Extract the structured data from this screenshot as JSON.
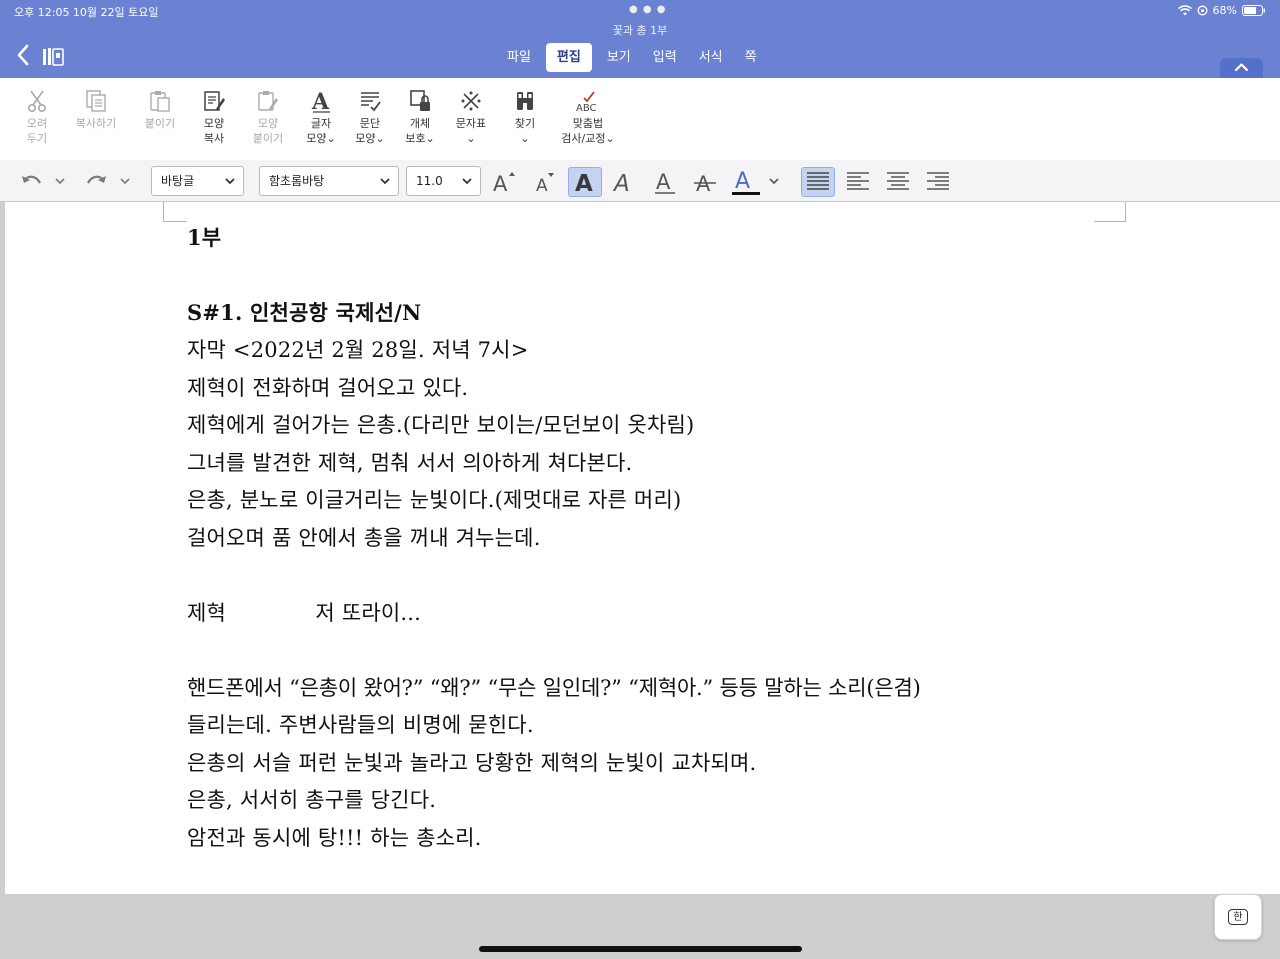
{
  "status_bar": {
    "time_date": "오후 12:05   10월 22일 토요일",
    "battery": "68%"
  },
  "document_title": "꽃과 총 1부",
  "tabs": [
    {
      "label": "파일"
    },
    {
      "label": "편집",
      "active": true
    },
    {
      "label": "보기"
    },
    {
      "label": "입력"
    },
    {
      "label": "서식"
    },
    {
      "label": "쪽"
    }
  ],
  "ribbon": {
    "cut": "오려\n두기",
    "copy": "복사하기",
    "paste": "붙이기",
    "copy_format": "모양\n복사",
    "paste_format": "모양\n붙이기",
    "char_shape": "글자\n모양⌄",
    "para_shape": "문단\n모양⌄",
    "object_protect": "개체\n보호⌄",
    "symbols": "문자표\n⌄",
    "find": "찾기\n⌄",
    "spellcheck": "맞춤법\n검사/교정⌄"
  },
  "format_bar": {
    "style": "바탕글",
    "font": "함초롬바탕",
    "size": "11.0"
  },
  "document": {
    "lines": [
      "1부",
      "",
      "S#1. 인천공항 국제선/N",
      "자막 <2022년 2월 28일. 저녁 7시>",
      "제혁이 전화하며 걸어오고 있다.",
      "제혁에게 걸어가는 은총.(다리만 보이는/모던보이 옷차림)",
      "그녀를 발견한 제혁, 멈춰 서서 의아하게 쳐다본다.",
      "은총, 분노로 이글거리는 눈빛이다.(제멋대로 자른 머리)",
      "걸어오며 품 안에서 총을 꺼내 겨누는데.",
      "",
      "제혁             저 또라이...",
      "",
      "핸드폰에서 “은총이 왔어?” “왜?” “무슨 일인데?” “제혁아.” 등등 말하는 소리(은겸)",
      "들리는데. 주변사람들의 비명에 묻힌다.",
      "은총의 서슬 퍼런 눈빛과 놀라고 당황한 제혁의 눈빛이 교차되며.",
      "은총, 서서히 총구를 당긴다.",
      "암전과 동시에 탕!!! 하는 총소리."
    ]
  },
  "ime": {
    "label": "한"
  }
}
